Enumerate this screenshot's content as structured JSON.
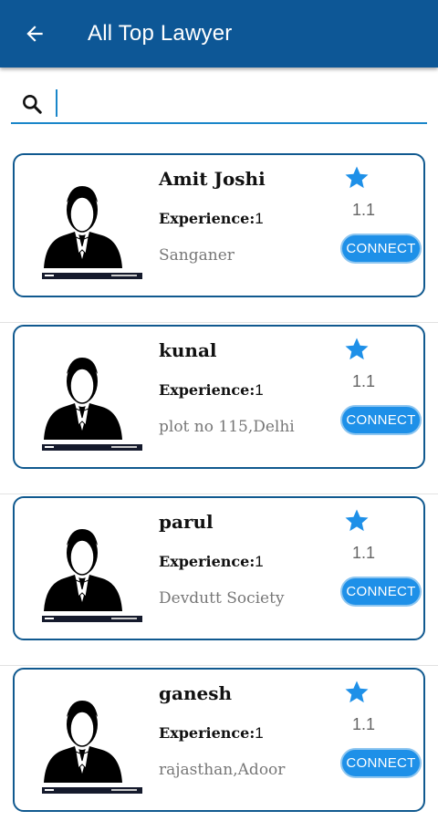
{
  "appbar": {
    "title": "All Top Lawyer",
    "back_icon": "arrow-left-icon",
    "background": "#0d5796"
  },
  "search": {
    "value": "",
    "placeholder": "",
    "icon": "search-icon",
    "accent": "#1a86c9"
  },
  "lawyers": [
    {
      "name": "Amit Joshi",
      "experience_label": "Experience:",
      "experience": "1",
      "address": "Sanganer",
      "rating": "1.1",
      "connect_label": "CONNECT"
    },
    {
      "name": "kunal",
      "experience_label": "Experience:",
      "experience": "1",
      "address": "plot no 115,Delhi",
      "rating": "1.1",
      "connect_label": "CONNECT"
    },
    {
      "name": "parul",
      "experience_label": "Experience:",
      "experience": "1",
      "address": "Devdutt Society",
      "rating": "1.1",
      "connect_label": "CONNECT"
    },
    {
      "name": "ganesh",
      "experience_label": "Experience:",
      "experience": "1",
      "address": "rajasthan,Adoor",
      "rating": "1.1",
      "connect_label": "CONNECT"
    }
  ],
  "colors": {
    "card_border": "#10598f",
    "star": "#1e90e8",
    "connect_button": "#1e90e8"
  }
}
